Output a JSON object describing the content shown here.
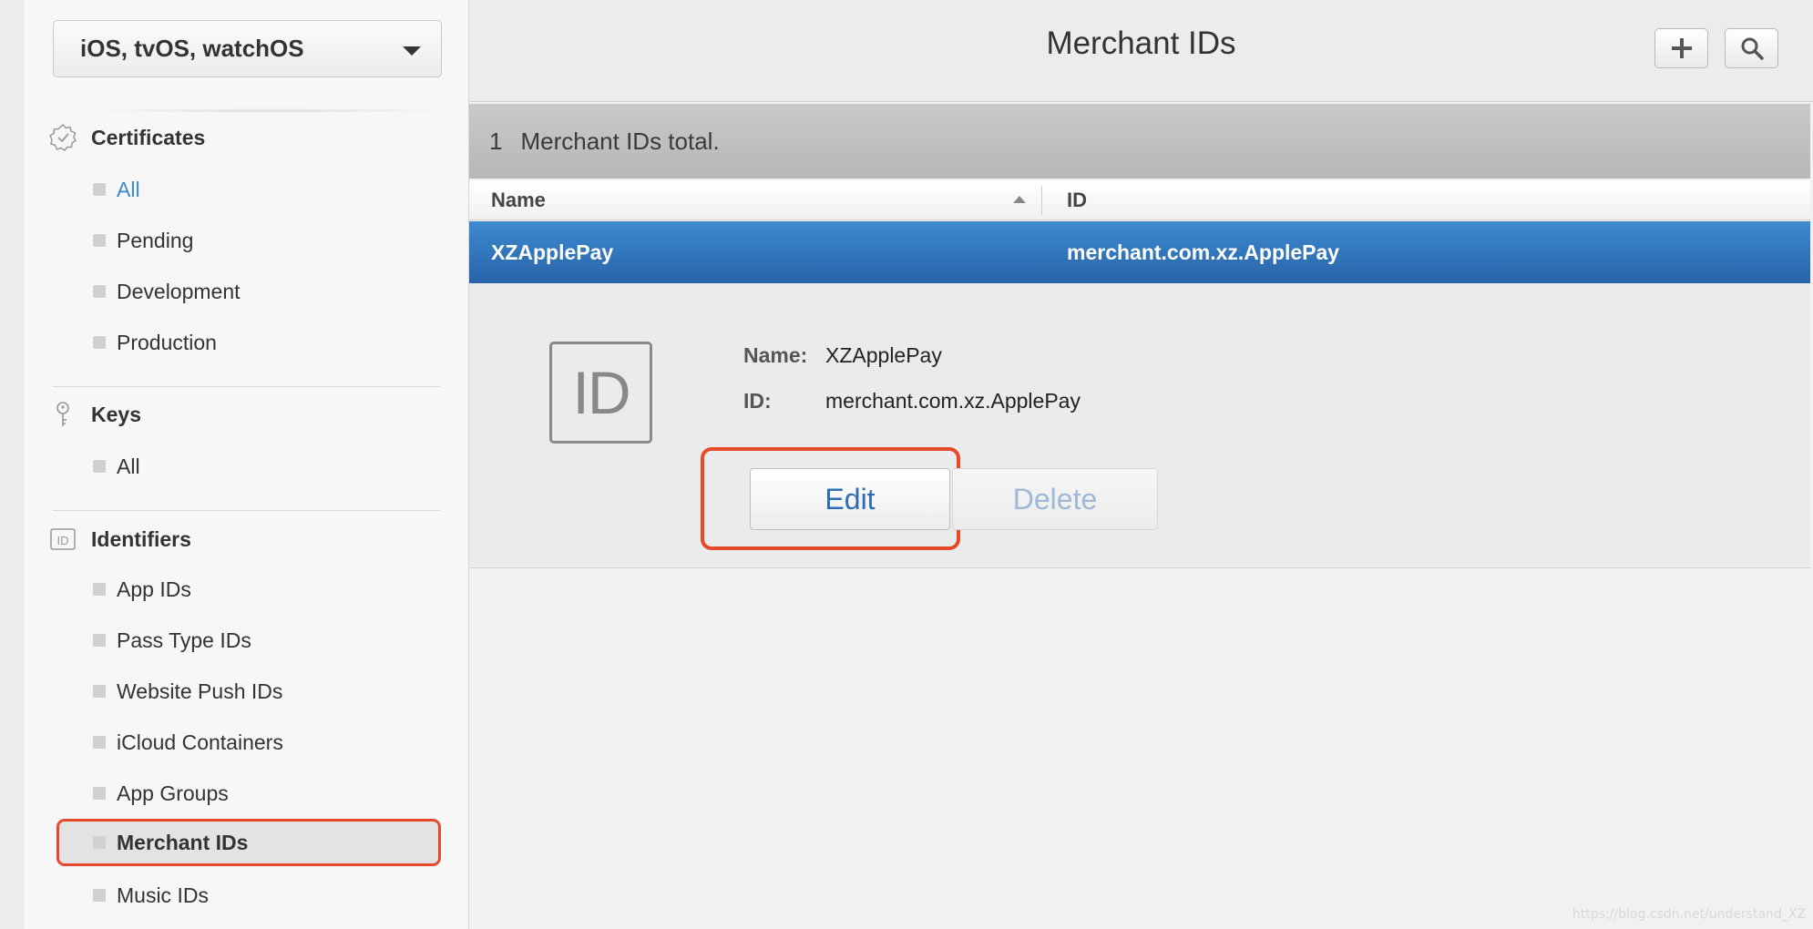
{
  "sidebar": {
    "platform_select": "iOS, tvOS, watchOS",
    "groups": [
      {
        "title": "Certificates",
        "icon": "certificate-badge-icon",
        "items": [
          "All",
          "Pending",
          "Development",
          "Production"
        ]
      },
      {
        "title": "Keys",
        "icon": "key-icon",
        "items": [
          "All"
        ]
      },
      {
        "title": "Identifiers",
        "icon": "id-icon",
        "items": [
          "App IDs",
          "Pass Type IDs",
          "Website Push IDs",
          "iCloud Containers",
          "App Groups",
          "Merchant IDs",
          "Music IDs"
        ]
      }
    ],
    "active_link": "All",
    "selected_item": "Merchant IDs"
  },
  "main": {
    "title": "Merchant IDs",
    "toolbar": {
      "add_icon": "plus-icon",
      "search_icon": "search-icon"
    },
    "count": "1",
    "count_label": "Merchant IDs total.",
    "table": {
      "columns": [
        "Name",
        "ID"
      ],
      "rows": [
        {
          "name": "XZApplePay",
          "id": "merchant.com.xz.ApplePay"
        }
      ]
    },
    "detail": {
      "badge": "ID",
      "name_label": "Name:",
      "name_value": "XZApplePay",
      "id_label": "ID:",
      "id_value": "merchant.com.xz.ApplePay",
      "edit_label": "Edit",
      "delete_label": "Delete"
    }
  },
  "colors": {
    "highlight": "#e64a2b",
    "selected_row": "#2f72bc",
    "link": "#3a8ac9"
  },
  "watermark": "https://blog.csdn.net/understand_XZ"
}
